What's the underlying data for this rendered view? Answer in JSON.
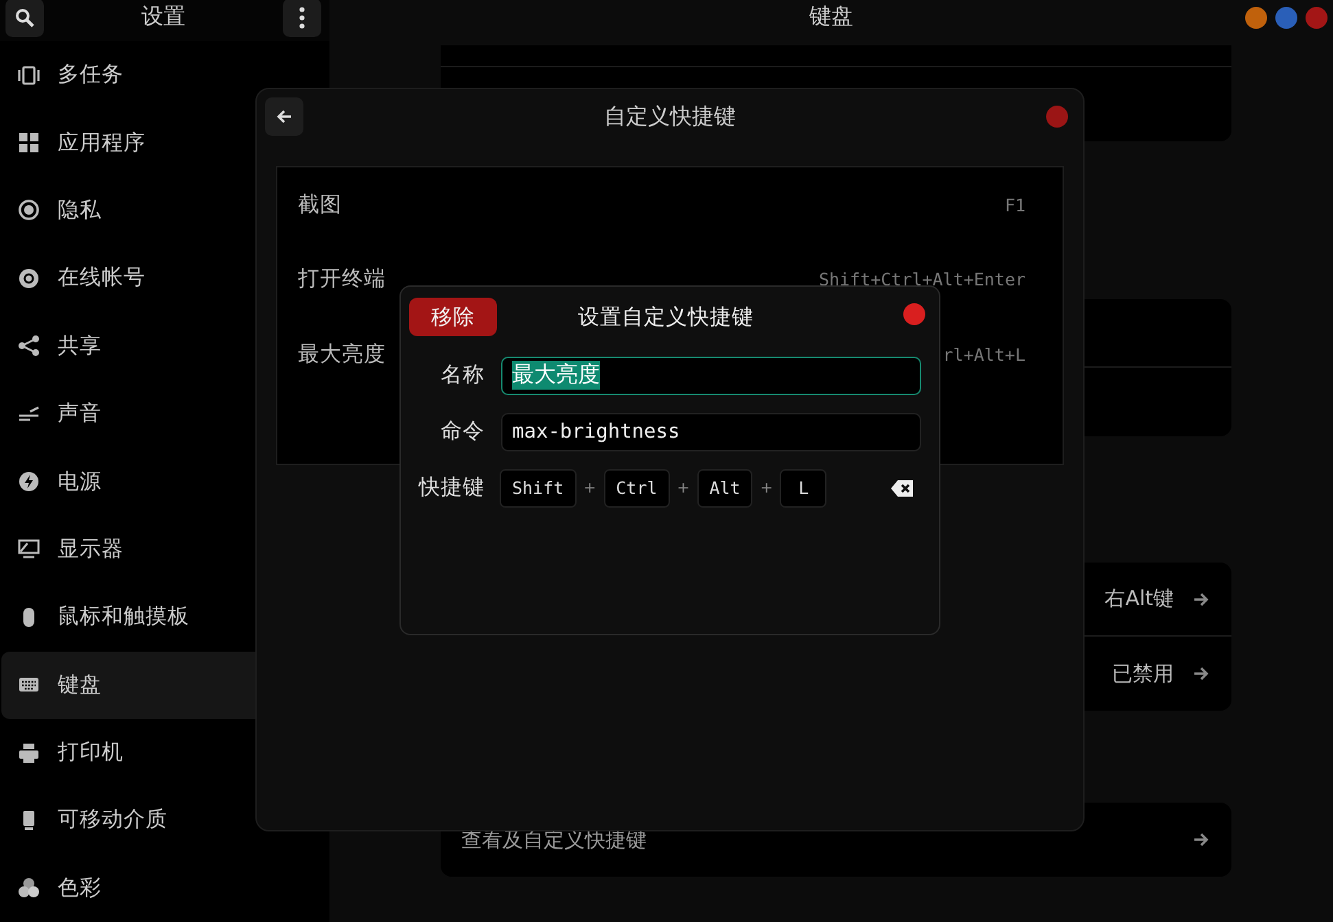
{
  "sidebar": {
    "title": "设置",
    "items": [
      {
        "label": "多任务",
        "selected": false
      },
      {
        "label": "应用程序",
        "selected": false
      },
      {
        "label": "隐私",
        "selected": false
      },
      {
        "label": "在线帐号",
        "selected": false
      },
      {
        "label": "共享",
        "selected": false
      },
      {
        "label": "声音",
        "selected": false
      },
      {
        "label": "电源",
        "selected": false
      },
      {
        "label": "显示器",
        "selected": false
      },
      {
        "label": "鼠标和触摸板",
        "selected": false
      },
      {
        "label": "键盘",
        "selected": true
      },
      {
        "label": "打印机",
        "selected": false
      },
      {
        "label": "可移动介质",
        "selected": false
      },
      {
        "label": "色彩",
        "selected": false
      }
    ]
  },
  "main": {
    "title": "键盘",
    "rows": [
      {
        "value": "右Alt键"
      },
      {
        "value": "已禁用"
      }
    ],
    "shortcuts_link": {
      "label": "查看及自定义快捷键"
    }
  },
  "shortcuts_dialog": {
    "title": "自定义快捷键",
    "shortcuts": [
      {
        "name": "截图",
        "keys": "F1"
      },
      {
        "name": "打开终端",
        "keys": "Shift+Ctrl+Alt+Enter"
      },
      {
        "name": "最大亮度",
        "keys": "rl+Alt+L"
      }
    ]
  },
  "edit_dialog": {
    "remove_button": "移除",
    "title": "设置自定义快捷键",
    "fields": [
      {
        "label": "名称",
        "value": "最大亮度",
        "focused": true
      },
      {
        "label": "命令",
        "value": "max-brightness",
        "focused": false
      }
    ],
    "shortcut_label": "快捷键",
    "shortcut": [
      {
        "kind": "key",
        "text": "Shift"
      },
      {
        "kind": "plus",
        "text": "+"
      },
      {
        "kind": "key",
        "text": "Ctrl"
      },
      {
        "kind": "plus",
        "text": "+"
      },
      {
        "kind": "key",
        "text": "Alt"
      },
      {
        "kind": "plus",
        "text": "+"
      },
      {
        "kind": "key",
        "text": "L"
      }
    ]
  }
}
